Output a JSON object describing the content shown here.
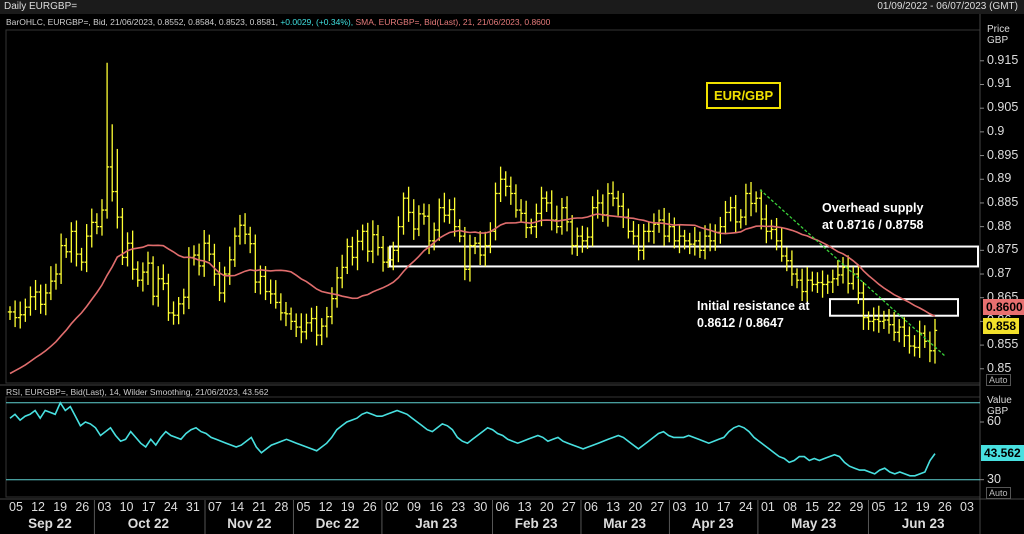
{
  "window": {
    "title": "Daily EURGBP=",
    "date_range": "01/09/2022 - 06/07/2023 (GMT)"
  },
  "price_panel": {
    "legend_prefix": "BarOHLC, EURGBP=, Bid, 21/06/2023, 0.8552, 0.8584, 0.8523, 0.8581, ",
    "legend_change": "+0.0029, (+0.34%),",
    "legend_sma": " SMA, EURGBP=, Bid(Last), 21, 21/06/2023, 0.8600",
    "axis_title_1": "Price",
    "axis_title_2": "GBP",
    "auto_label": "Auto",
    "sma_tag": "0.8600",
    "last_tag": "0.858",
    "title_box": "EUR/GBP",
    "annotation_supply": [
      "Overhead supply",
      "at 0.8716 / 0.8758"
    ],
    "annotation_resistance": [
      "Initial resistance at",
      "0.8612 / 0.8647"
    ]
  },
  "rsi_panel": {
    "legend": "RSI, EURGBP=, Bid(Last), 14, Wilder Smoothing, 21/06/2023, 43.562",
    "axis_title_1": "Value",
    "axis_title_2": "GBP",
    "auto_label": "Auto",
    "last_tag": "43.562"
  },
  "colors": {
    "bars": "#ffff33",
    "sma": "#e06d6d",
    "rsi": "#48e0e0",
    "rsi_bands": "#5fcfcf",
    "trendline": "#3ad23a",
    "boxes": "#ffffff"
  },
  "chart_data": [
    {
      "type": "bar",
      "subtype": "ohlc",
      "title": "",
      "series": [
        {
          "name": "EURGBP=",
          "values_close": [
            0.862,
            0.8608,
            0.8614,
            0.863,
            0.8652,
            0.8662,
            0.8636,
            0.866,
            0.8685,
            0.87,
            0.876,
            0.8747,
            0.879,
            0.8742,
            0.8725,
            0.878,
            0.8809,
            0.88,
            0.8835,
            0.8926,
            0.8874,
            0.882,
            0.8735,
            0.8765,
            0.871,
            0.8687,
            0.8704,
            0.8723,
            0.8653,
            0.869,
            0.868,
            0.8618,
            0.8613,
            0.8637,
            0.8651,
            0.8735,
            0.874,
            0.8717,
            0.8765,
            0.8742,
            0.87,
            0.866,
            0.87,
            0.873,
            0.878,
            0.8803,
            0.8784,
            0.8764,
            0.8683,
            0.8695,
            0.8663,
            0.8658,
            0.864,
            0.8618,
            0.8616,
            0.86,
            0.8588,
            0.8578,
            0.8597,
            0.8606,
            0.8571,
            0.859,
            0.861,
            0.8648,
            0.8692,
            0.8714,
            0.8758,
            0.8735,
            0.8769,
            0.879,
            0.8748,
            0.8783,
            0.8756,
            0.8725,
            0.873,
            0.875,
            0.88,
            0.886,
            0.883,
            0.8795,
            0.8827,
            0.8822,
            0.877,
            0.8793,
            0.884,
            0.8824,
            0.8836,
            0.88,
            0.878,
            0.871,
            0.876,
            0.8765,
            0.874,
            0.876,
            0.879,
            0.887,
            0.89,
            0.8885,
            0.887,
            0.8835,
            0.8828,
            0.8798,
            0.88,
            0.8828,
            0.886,
            0.885,
            0.8814,
            0.88,
            0.884,
            0.881,
            0.876,
            0.878,
            0.877,
            0.8778,
            0.884,
            0.885,
            0.8825,
            0.887,
            0.886,
            0.8843,
            0.882,
            0.879,
            0.878,
            0.875,
            0.879,
            0.879,
            0.8805,
            0.8814,
            0.878,
            0.88,
            0.877,
            0.878,
            0.877,
            0.8763,
            0.877,
            0.875,
            0.878,
            0.877,
            0.8788,
            0.88,
            0.883,
            0.884,
            0.881,
            0.882,
            0.887,
            0.8849,
            0.886,
            0.8816,
            0.879,
            0.8794,
            0.877,
            0.8738,
            0.8728,
            0.87,
            0.8687,
            0.8663,
            0.8687,
            0.8678,
            0.8682,
            0.8678,
            0.8683,
            0.869,
            0.8698,
            0.8714,
            0.868,
            0.87,
            0.866,
            0.8608,
            0.86,
            0.8604,
            0.86,
            0.8603,
            0.8593,
            0.8577,
            0.8588,
            0.857,
            0.8548,
            0.8545,
            0.8575,
            0.8558,
            0.8538,
            0.8581
          ]
        }
      ],
      "ylim": [
        0.847,
        0.9215
      ],
      "yticks": [
        0.85,
        0.855,
        0.86,
        0.865,
        0.87,
        0.875,
        0.88,
        0.885,
        0.89,
        0.895,
        0.9,
        0.905,
        0.91,
        0.915
      ],
      "ytick_labels": [
        "0.85",
        "0.855",
        "0.86",
        "0.865",
        "0.87",
        "0.875",
        "0.88",
        "0.885",
        "0.89",
        "0.895",
        "0.9",
        "0.905",
        "0.91",
        "0.915"
      ],
      "overlays": {
        "sma_21_last": 0.86,
        "supply_zone": [
          0.8716,
          0.8758
        ],
        "resistance_zone": [
          0.8612,
          0.8647
        ]
      }
    },
    {
      "type": "line",
      "title": "",
      "series": [
        {
          "name": "RSI",
          "values": [
            62,
            64,
            61,
            63,
            64,
            66,
            62,
            66,
            65,
            64,
            70,
            66,
            68,
            63,
            58,
            60,
            59,
            57,
            53,
            55,
            57,
            53,
            50,
            51,
            55,
            52,
            49,
            47,
            51,
            48,
            52,
            55,
            53,
            52,
            51,
            54,
            56,
            57,
            55,
            54,
            52,
            51,
            50,
            49,
            48,
            47,
            48,
            50,
            52,
            47,
            44,
            46,
            48,
            49,
            50,
            51,
            50,
            49,
            48,
            47,
            46,
            45,
            47,
            49,
            52,
            56,
            58,
            60,
            61,
            62,
            64,
            65,
            64,
            63,
            63,
            64,
            65,
            66,
            65,
            64,
            62,
            60,
            58,
            56,
            55,
            57,
            59,
            58,
            56,
            52,
            50,
            49,
            51,
            53,
            55,
            57,
            56,
            54,
            53,
            51,
            50,
            49,
            50,
            51,
            52,
            53,
            52,
            50,
            51,
            52,
            50,
            49,
            48,
            47,
            46,
            47,
            48,
            49,
            50,
            51,
            52,
            53,
            52,
            50,
            48,
            46,
            48,
            50,
            52,
            54,
            55,
            53,
            52,
            52,
            52,
            53,
            52,
            51,
            50,
            49,
            50,
            51,
            52,
            55,
            57,
            58,
            57,
            55,
            52,
            50,
            48,
            46,
            44,
            42,
            41,
            39,
            40,
            42,
            42,
            40,
            41,
            40,
            41,
            42,
            43,
            42,
            39,
            37,
            36,
            35,
            35,
            34,
            33,
            35,
            36,
            34,
            33,
            34,
            33,
            32,
            32,
            33,
            34,
            40,
            43.562
          ]
        }
      ],
      "ylim": [
        21,
        73
      ],
      "yticks": [
        30,
        60
      ],
      "ytick_labels": [
        "30",
        "60"
      ],
      "bands": [
        30,
        70
      ]
    }
  ],
  "x_axis": {
    "day_labels": [
      "05",
      "12",
      "19",
      "26",
      "03",
      "10",
      "17",
      "24",
      "31",
      "07",
      "14",
      "21",
      "28",
      "05",
      "12",
      "19",
      "26",
      "02",
      "09",
      "16",
      "23",
      "30",
      "06",
      "13",
      "20",
      "27",
      "06",
      "13",
      "20",
      "27",
      "03",
      "10",
      "17",
      "24",
      "01",
      "08",
      "15",
      "22",
      "29",
      "05",
      "12",
      "19",
      "26",
      "03"
    ],
    "month_labels": [
      "Sep 22",
      "Oct 22",
      "Nov 22",
      "Dec 22",
      "Jan 23",
      "Feb 23",
      "Mar 23",
      "Apr 23",
      "May 23",
      "Jun 23"
    ]
  }
}
